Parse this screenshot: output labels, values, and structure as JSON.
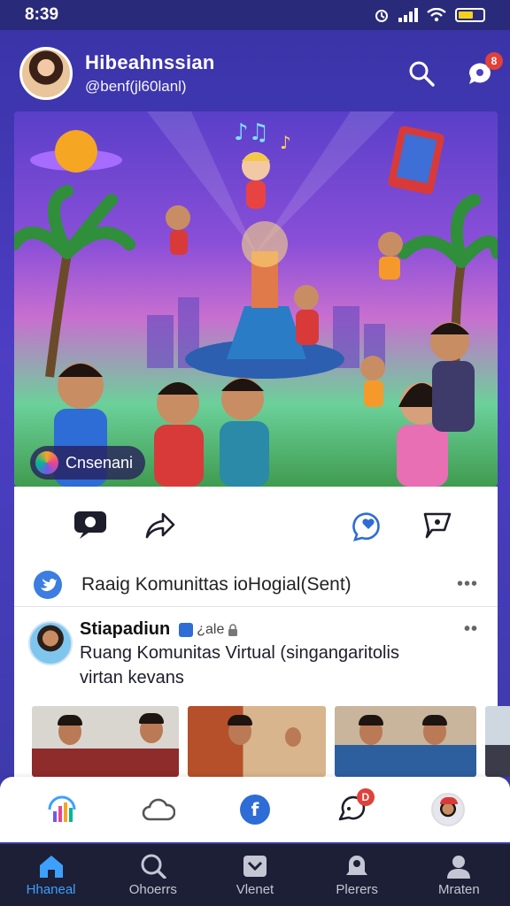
{
  "status_bar": {
    "time": "8:39"
  },
  "header": {
    "name": "Hibeahnssian",
    "handle": "@benf(jl60lanl)",
    "notification_badge": "8"
  },
  "hero": {
    "chip_label": "Cnsenani"
  },
  "post": {
    "title": "Raaig Komunittas ioHogial(Sent)",
    "more": "•••"
  },
  "feed": {
    "author": "Stiapadiun",
    "tag": "¿ale",
    "text_line1": "Ruang Komunitas Virtual (singangaritolis",
    "text_line2": "virtan kevans",
    "more": "••"
  },
  "app_row": {
    "message_badge": "D"
  },
  "bottom_nav": {
    "items": [
      {
        "label": "Hhaneal",
        "icon": "home-icon"
      },
      {
        "label": "Ohoerrs",
        "icon": "search-icon"
      },
      {
        "label": "Vlenet",
        "icon": "inbox-icon"
      },
      {
        "label": "Plerers",
        "icon": "bell-icon"
      },
      {
        "label": "Mraten",
        "icon": "profile-icon"
      }
    ]
  },
  "colors": {
    "accent": "#3da0ff",
    "brand_purple": "#4d3ec4",
    "badge_red": "#e0413b",
    "nav_bg": "#1c1f36"
  }
}
